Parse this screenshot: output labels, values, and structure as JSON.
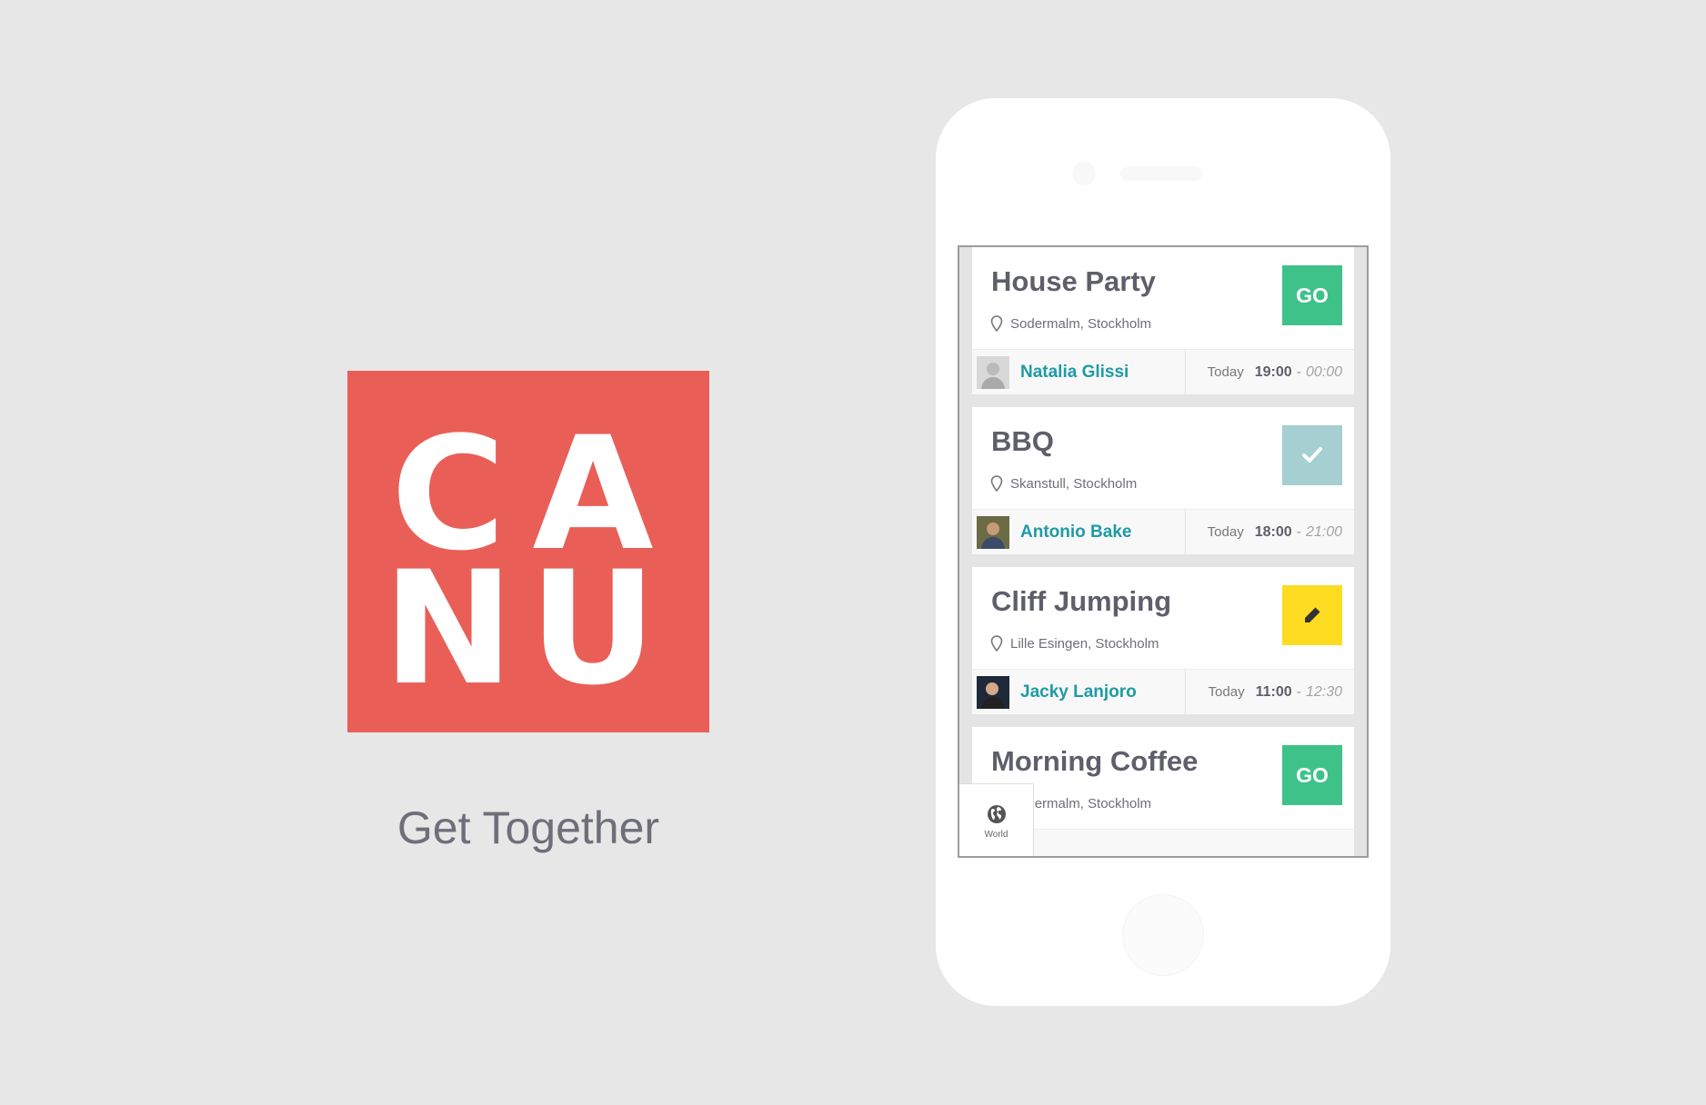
{
  "logo": {
    "letters": [
      "C",
      "A",
      "N",
      "U"
    ],
    "color": "#e95f57"
  },
  "tagline": "Get Together",
  "events": [
    {
      "title": "House Party",
      "location": "Sodermalm, Stockholm",
      "action": {
        "type": "go",
        "label": "GO",
        "color": "#3ec289",
        "icon": ""
      },
      "host": "Natalia Glissi",
      "day": "Today",
      "start": "19:00",
      "separator": "-",
      "end": "00:00"
    },
    {
      "title": "BBQ",
      "location": "Skanstull, Stockholm",
      "action": {
        "type": "joined",
        "label": "",
        "color": "#a5cfd1",
        "icon": "checkmark-icon"
      },
      "host": "Antonio Bake",
      "day": "Today",
      "start": "18:00",
      "separator": "-",
      "end": "21:00"
    },
    {
      "title": "Cliff Jumping",
      "location": "Lille Esingen, Stockholm",
      "action": {
        "type": "edit",
        "label": "",
        "color": "#fddc22",
        "icon": "pencil-icon"
      },
      "host": "Jacky Lanjoro",
      "day": "Today",
      "start": "11:00",
      "separator": "-",
      "end": "12:30"
    },
    {
      "title": "Morning Coffee",
      "location": "Sodermalm, Stockholm",
      "action": {
        "type": "go",
        "label": "GO",
        "color": "#3ec289",
        "icon": ""
      },
      "host": "",
      "day": "",
      "start": "",
      "separator": "",
      "end": ""
    }
  ],
  "world_tab": {
    "label": "World",
    "icon": "globe-icon"
  }
}
